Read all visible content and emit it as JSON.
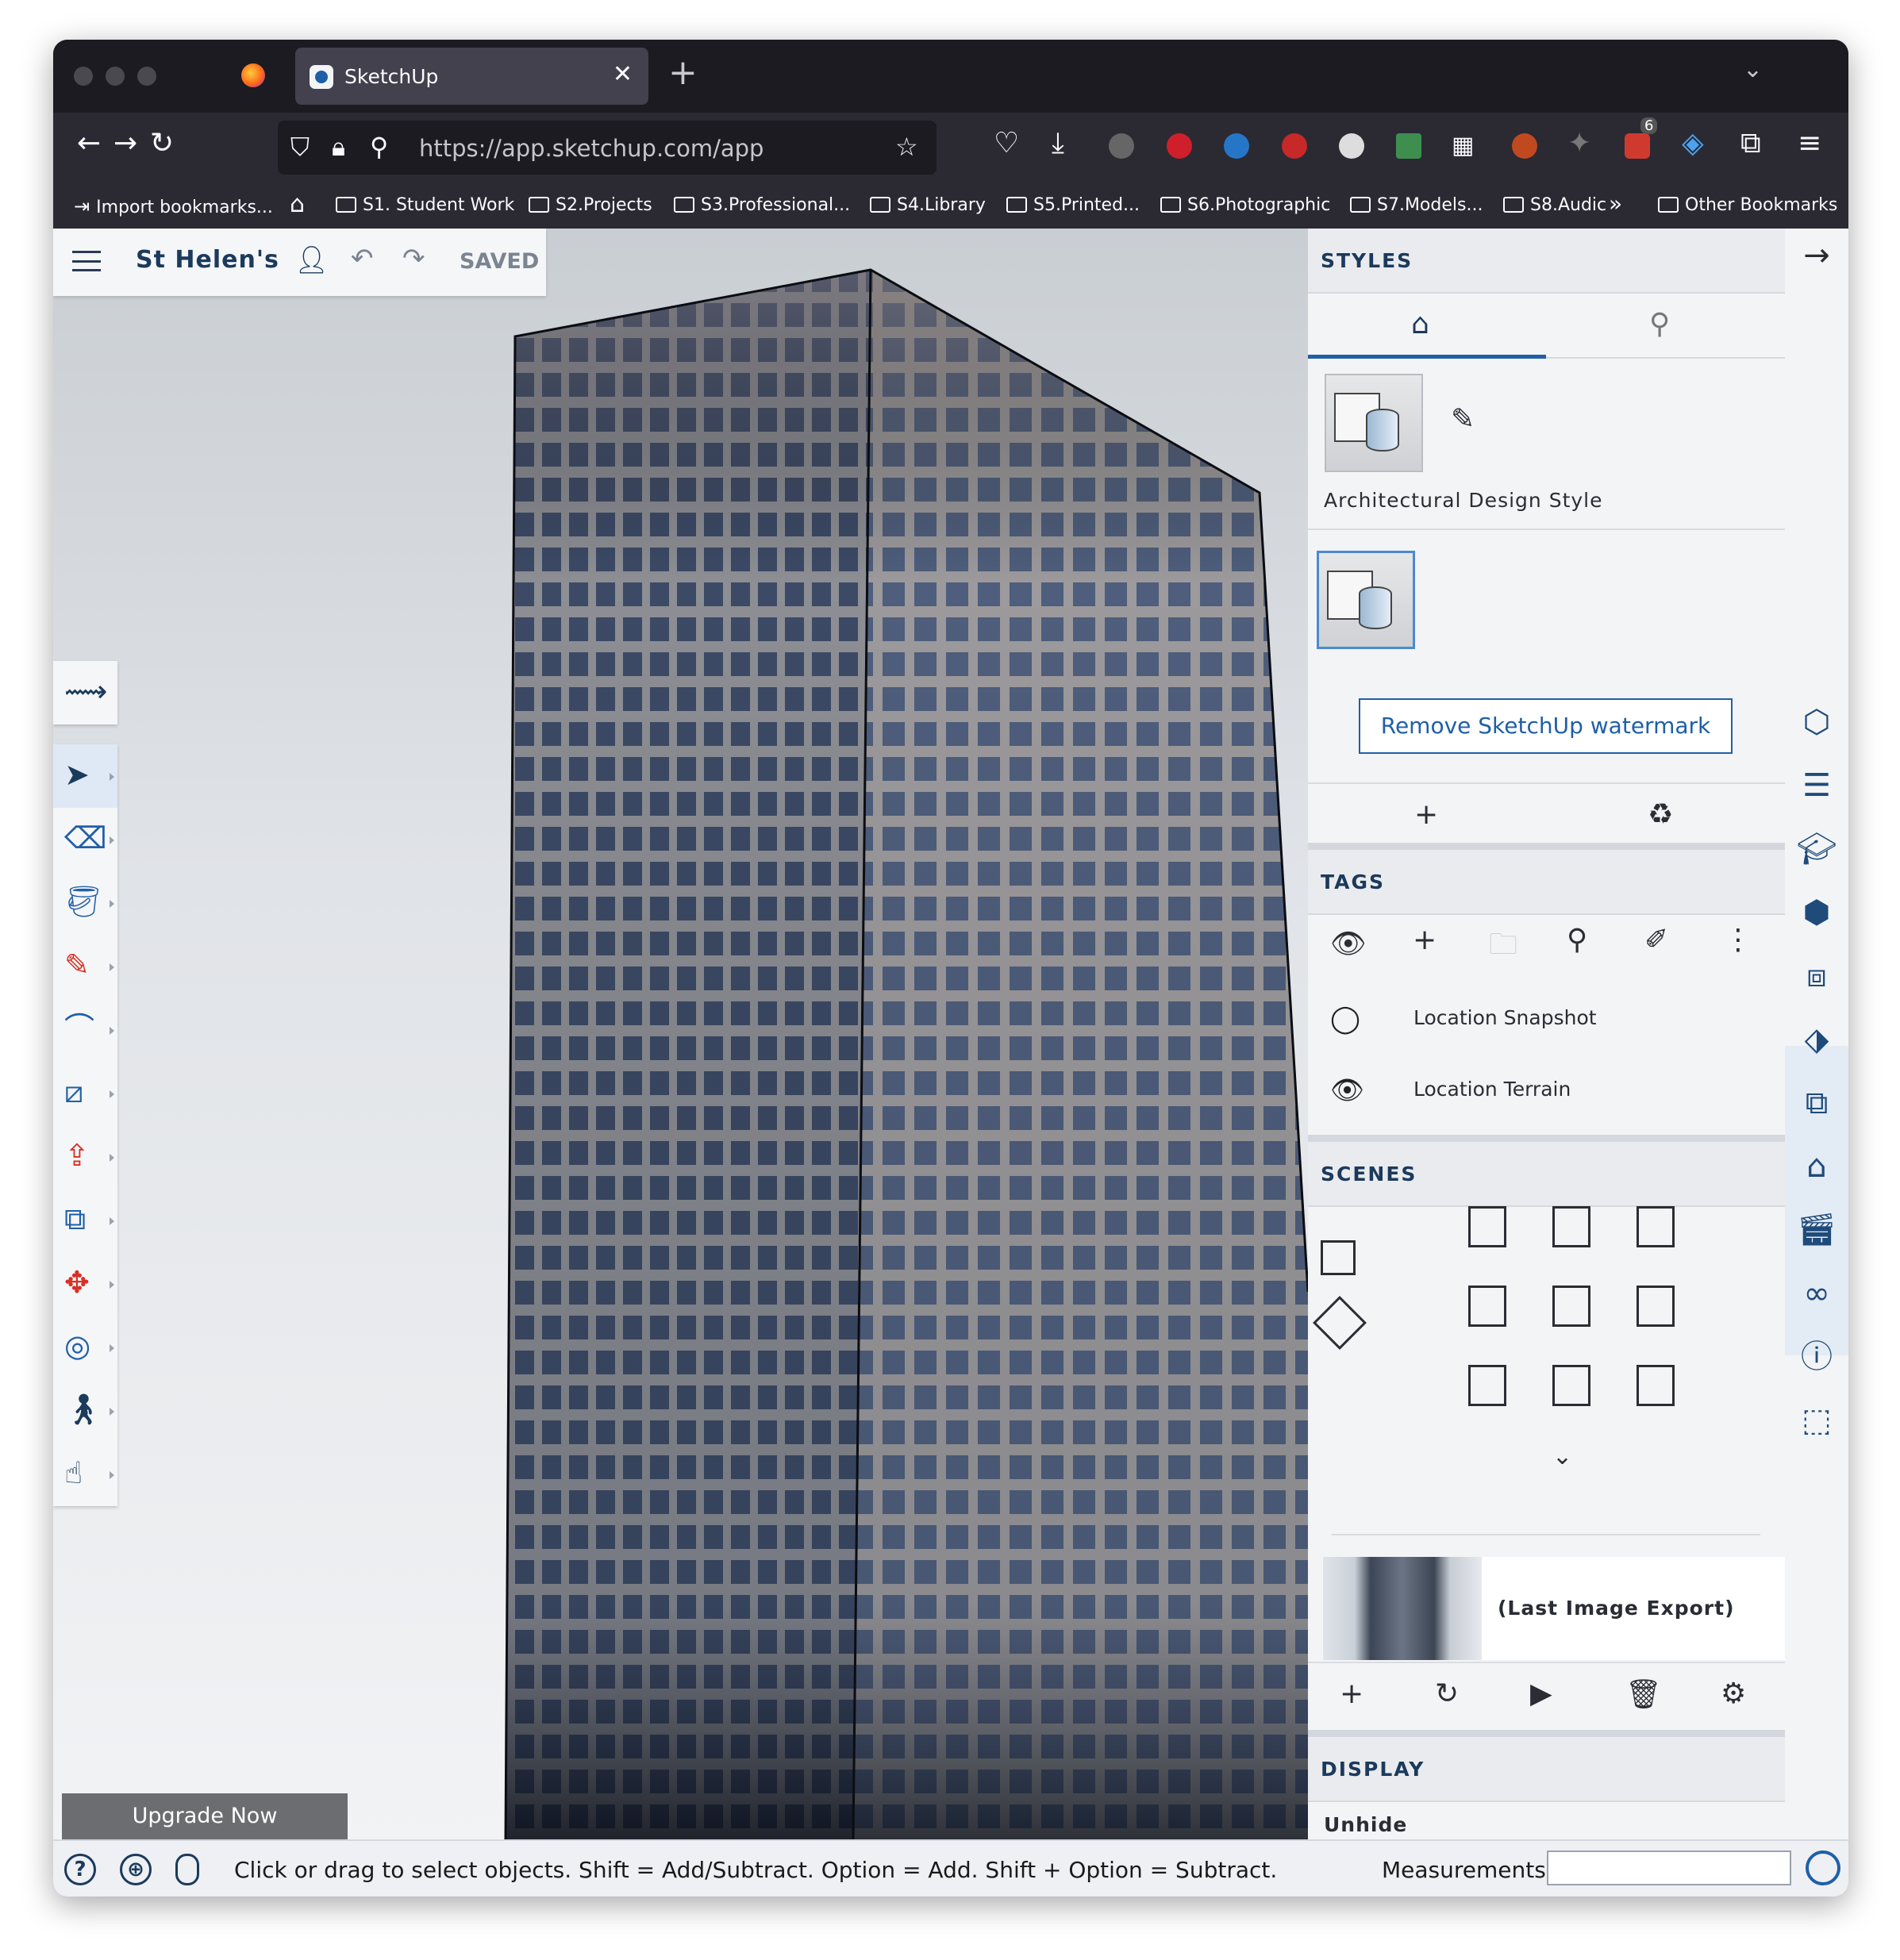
{
  "browser": {
    "tab_title": "SketchUp",
    "url": "https://app.sketchup.com/app",
    "extension_badge": "6",
    "bookmarks": [
      {
        "label": "Import bookmarks..."
      },
      {
        "label": "S1. Student Work"
      },
      {
        "label": "S2.Projects"
      },
      {
        "label": "S3.Professional..."
      },
      {
        "label": "S4.Library"
      },
      {
        "label": "S5.Printed..."
      },
      {
        "label": "S6.Photographic"
      },
      {
        "label": "S7.Models..."
      },
      {
        "label": "S8.Audic"
      },
      {
        "label": "Other Bookmarks"
      }
    ]
  },
  "app": {
    "project_name": "St Helen's",
    "save_status": "SAVED",
    "upgrade_label": "Upgrade Now"
  },
  "styles": {
    "header": "STYLES",
    "current_style": "Architectural Design Style",
    "watermark_button": "Remove SketchUp watermark"
  },
  "tags": {
    "header": "TAGS",
    "items": [
      {
        "label": "Location Snapshot",
        "visible": false
      },
      {
        "label": "Location Terrain",
        "visible": true
      }
    ]
  },
  "scenes": {
    "header": "SCENES",
    "last_export_label": "(Last Image Export)"
  },
  "display": {
    "header": "DISPLAY",
    "unhide_label": "Unhide"
  },
  "status": {
    "message": "Click or drag to select objects. Shift = Add/Subtract. Option = Add. Shift + Option = Subtract.",
    "measurements_label": "Measurements",
    "measurements_value": ""
  },
  "colors": {
    "accent": "#1f5fa8",
    "brand_dark": "#1b3a5c"
  }
}
